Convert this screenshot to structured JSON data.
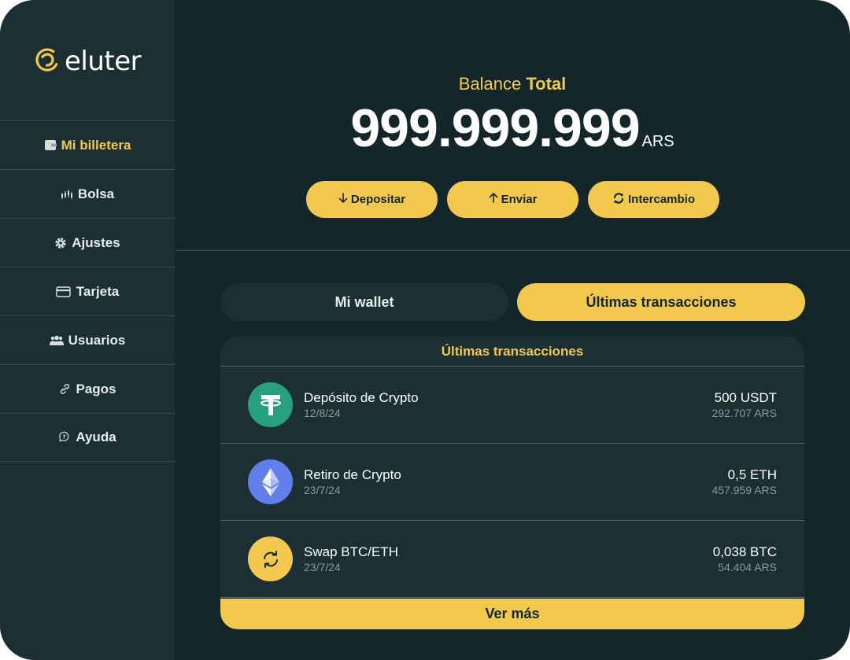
{
  "brand": {
    "name": "eluter",
    "accent": "#f2c94c",
    "background": "#132629",
    "panel": "#1c3034"
  },
  "sidebar": {
    "items": [
      {
        "label": "Mi billetera",
        "icon": "wallet-icon",
        "active": true
      },
      {
        "label": "Bolsa",
        "icon": "candlestick-icon",
        "active": false
      },
      {
        "label": "Ajustes",
        "icon": "gear-icon",
        "active": false
      },
      {
        "label": "Tarjeta",
        "icon": "card-icon",
        "active": false
      },
      {
        "label": "Usuarios",
        "icon": "users-icon",
        "active": false
      },
      {
        "label": "Pagos",
        "icon": "link-icon",
        "active": false
      },
      {
        "label": "Ayuda",
        "icon": "help-chat-icon",
        "active": false
      }
    ]
  },
  "balance": {
    "title_prefix": "Balance",
    "title_bold": "Total",
    "amount": "999.999.999",
    "currency": "ARS"
  },
  "actions": [
    {
      "label": "Depositar",
      "icon": "arrow-down-icon"
    },
    {
      "label": "Enviar",
      "icon": "arrow-up-icon"
    },
    {
      "label": "Intercambio",
      "icon": "swap-icon"
    }
  ],
  "tabs": [
    {
      "label": "Mi wallet",
      "active": false
    },
    {
      "label": "Últimas transacciones",
      "active": true
    }
  ],
  "transactions": {
    "title": "Últimas transacciones",
    "items": [
      {
        "name": "Depósito de Crypto",
        "date": "12/8/24",
        "amount": "500 USDT",
        "fiat": "292.707 ARS",
        "icon": "tether-icon",
        "icon_color": "#26a17b"
      },
      {
        "name": "Retiro de Crypto",
        "date": "23/7/24",
        "amount": "0,5 ETH",
        "fiat": "457.959 ARS",
        "icon": "ethereum-icon",
        "icon_color": "#627eea"
      },
      {
        "name": "Swap BTC/ETH",
        "date": "23/7/24",
        "amount": "0,038 BTC",
        "fiat": "54.404 ARS",
        "icon": "swap-circle-icon",
        "icon_color": "#f2c94c"
      }
    ],
    "see_more": "Ver más"
  }
}
